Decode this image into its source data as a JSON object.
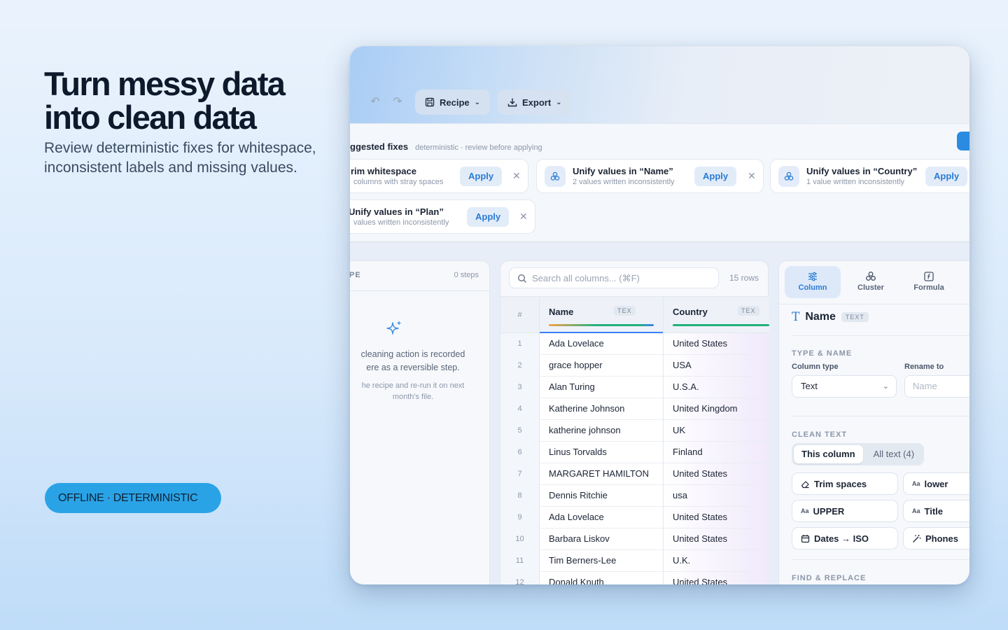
{
  "hero": {
    "title": "Turn messy data into clean data",
    "subtitle": "Review deterministic fixes for whitespace, inconsistent labels and missing values.",
    "badge": "OFFLINE · DETERMINISTIC"
  },
  "toolbar": {
    "recipe_label": "Recipe",
    "export_label": "Export"
  },
  "fixes": {
    "title": "ggested fixes",
    "hint": "deterministic · review before applying",
    "apply_label": "Apply",
    "cards": [
      {
        "title": "rim whitespace",
        "sub": "columns with stray spaces"
      },
      {
        "title": "Unify values in “Name”",
        "sub": "2 values written inconsistently"
      },
      {
        "title": "Unify values in “Country”",
        "sub": "1 value written inconsistently"
      },
      {
        "title": "Unify values in “Plan”",
        "sub": "values written inconsistently"
      }
    ]
  },
  "recipe": {
    "title": "PE",
    "steps": "0 steps",
    "empty_line1": "cleaning action is recorded ere as a reversible step.",
    "empty_line2": "he recipe and re-run it on next month's file."
  },
  "grid": {
    "search_placeholder": "Search all columns... (⌘F)",
    "row_count": "15 rows",
    "num_header": "#",
    "columns": [
      {
        "name": "Name",
        "type": "TEX",
        "bar_color": "#3b82f6"
      },
      {
        "name": "Country",
        "type": "TEX",
        "bar_color": "#22b07d"
      }
    ],
    "rows": [
      {
        "n": "1",
        "name": "Ada Lovelace",
        "country": "United States"
      },
      {
        "n": "2",
        "name": "grace hopper",
        "country": "USA"
      },
      {
        "n": "3",
        "name": "Alan Turing",
        "country": "U.S.A."
      },
      {
        "n": "4",
        "name": "Katherine Johnson",
        "country": "United Kingdom"
      },
      {
        "n": "5",
        "name": "katherine johnson",
        "country": "UK"
      },
      {
        "n": "6",
        "name": "Linus Torvalds",
        "country": "Finland"
      },
      {
        "n": "7",
        "name": "MARGARET HAMILTON",
        "country": "United States"
      },
      {
        "n": "8",
        "name": "Dennis Ritchie",
        "country": "usa"
      },
      {
        "n": "9",
        "name": "Ada Lovelace",
        "country": "United States"
      },
      {
        "n": "10",
        "name": "Barbara Liskov",
        "country": "United States"
      },
      {
        "n": "11",
        "name": "Tim Berners-Lee",
        "country": "U.K."
      },
      {
        "n": "12",
        "name": "Donald Knuth",
        "country": "United States"
      }
    ]
  },
  "inspector": {
    "tabs": [
      "Column",
      "Cluster",
      "Formula"
    ],
    "column_name": "Name",
    "column_type": "TEXT",
    "type_name_title": "TYPE & NAME",
    "column_type_label": "Column type",
    "column_type_value": "Text",
    "rename_label": "Rename to",
    "rename_placeholder": "Name",
    "clean_text_title": "CLEAN TEXT",
    "scope_options": [
      "This column",
      "All text (4)"
    ],
    "actions": {
      "trim": "Trim spaces",
      "lower": "lower",
      "upper": "UPPER",
      "title": "Title",
      "dates": "Dates → ISO",
      "phones": "Phones"
    },
    "find_replace_title": "FIND & REPLACE"
  },
  "colors": {
    "accent": "#2a7bd4",
    "badge": "#2aa3e6"
  }
}
